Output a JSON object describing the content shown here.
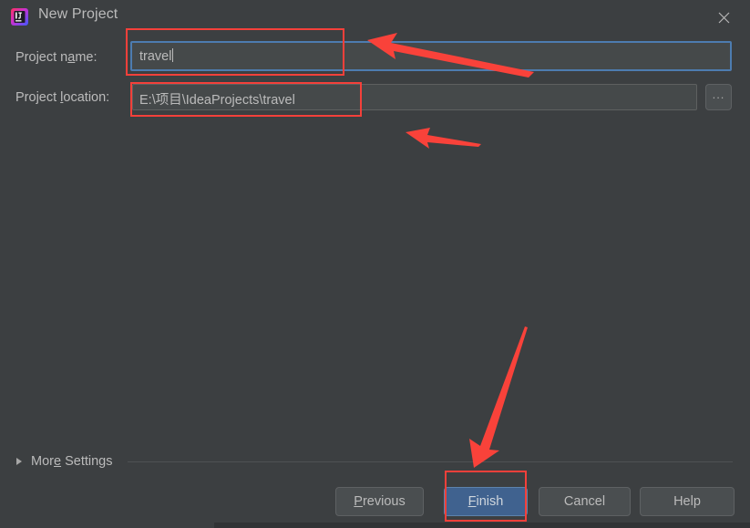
{
  "window": {
    "title": "New Project",
    "app_icon": "intellij-idea-icon",
    "close_icon": "close-icon",
    "background_color": "#3c3f41",
    "accent_color": "#4d7cb0",
    "annotation_color": "#f4403a"
  },
  "form": {
    "name_row": {
      "label_prefix": "Project n",
      "label_mnemonic": "a",
      "label_suffix": "me:",
      "value": "travel",
      "placeholder": "",
      "focused": true
    },
    "location_row": {
      "label_prefix": "Project ",
      "label_mnemonic": "l",
      "label_suffix": "ocation:",
      "value": "E:\\项目\\IdeaProjects\\travel",
      "placeholder": "",
      "browse_label": "..."
    }
  },
  "more_settings": {
    "label_prefix": "Mor",
    "label_mnemonic": "e",
    "label_suffix": " Settings",
    "expander_icon": "triangle-right-icon",
    "expanded": false
  },
  "buttons": {
    "previous": {
      "prefix": "",
      "mnemonic": "P",
      "suffix": "revious"
    },
    "finish": {
      "prefix": "",
      "mnemonic": "F",
      "suffix": "inish",
      "primary": true
    },
    "cancel": {
      "prefix": "Cancel",
      "mnemonic": "",
      "suffix": ""
    },
    "help": {
      "prefix": "Help",
      "mnemonic": "",
      "suffix": ""
    }
  },
  "annotations": {
    "boxes": [
      {
        "name": "project-name-field-highlight"
      },
      {
        "name": "project-location-field-highlight"
      },
      {
        "name": "finish-button-highlight"
      }
    ],
    "arrows": [
      {
        "name": "arrow-to-project-name"
      },
      {
        "name": "arrow-to-project-location"
      },
      {
        "name": "arrow-to-finish-button"
      }
    ]
  }
}
